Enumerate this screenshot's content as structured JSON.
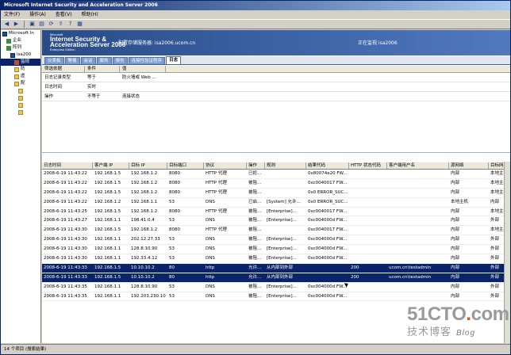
{
  "window": {
    "title": "Microsoft Internet Security and Acceleration Server 2006"
  },
  "menubar": [
    "文件(F)",
    "操作(A)",
    "查看(V)",
    "帮助(H)"
  ],
  "tree": [
    {
      "label": "Microsoft In",
      "icon": "server-icon",
      "indent": 0
    },
    {
      "label": "企业",
      "icon": "group-icon",
      "indent": 1
    },
    {
      "label": "阵列",
      "icon": "group-icon",
      "indent": 1
    },
    {
      "label": "isa200",
      "icon": "server-icon",
      "indent": 2
    },
    {
      "label": "监视",
      "icon": "monitor-icon",
      "indent": 3,
      "selected": true
    },
    {
      "label": "防",
      "icon": "folder-icon",
      "indent": 3
    },
    {
      "label": "虚",
      "icon": "folder-icon",
      "indent": 3
    },
    {
      "label": "配",
      "icon": "folder-icon",
      "indent": 3
    },
    {
      "label": "",
      "icon": "folder-icon",
      "indent": 4
    },
    {
      "label": "",
      "icon": "folder-icon",
      "indent": 4
    },
    {
      "label": "",
      "icon": "folder-icon",
      "indent": 4
    },
    {
      "label": "",
      "icon": "folder-icon",
      "indent": 4
    }
  ],
  "banner": {
    "logo_ms": "Microsoft",
    "logo_line1": "Internet Security &",
    "logo_line2": "Acceleration Server 2006",
    "logo_edition": "Enterprise Edition",
    "config_text": "配置存储服务器: isa2006.ucom.cn",
    "monitor_text": "正在监视 isa2006"
  },
  "tabs": [
    "仪表板",
    "警报",
    "会话",
    "服务",
    "报告",
    "连接性验证程序",
    "日志"
  ],
  "active_tab": 6,
  "filter": {
    "headers": [
      "筛选依据",
      "条件",
      "值"
    ],
    "rows": [
      [
        "日志记录类型",
        "等于",
        "防火墙或 Web ..."
      ],
      [
        "日志时间",
        "实时",
        ""
      ],
      [
        "操作",
        "不等于",
        "连接状态"
      ]
    ]
  },
  "log": {
    "headers": [
      "日志时间",
      "客户端 IP",
      "目标 IP",
      "目标端口",
      "协议",
      "操作",
      "规则",
      "结果代码",
      "HTTP 状态代码",
      "客户端用户名",
      "源网络",
      "目标网"
    ],
    "rows": [
      {
        "cells": [
          "2008-6-19 11:43:22",
          "192.168.1.5",
          "192.168.1.2",
          "8080",
          "HTTP 代理",
          "已拒...",
          "",
          "0x80074e20 FW...",
          "",
          "",
          "内部",
          "本地主"
        ],
        "selected": false
      },
      {
        "cells": [
          "2008-6-19 11:43:22",
          "192.168.1.5",
          "192.168.1.2",
          "8080",
          "HTTP 代理",
          "被阻...",
          "",
          "0xc0040017 FW...",
          "",
          "",
          "内部",
          "本地主"
        ],
        "selected": false
      },
      {
        "cells": [
          "2008-6-19 11:43:22",
          "192.168.1.5",
          "192.168.1.2",
          "8080",
          "HTTP 代理",
          "被阻...",
          "",
          "0x0 ERROR_SUC...",
          "",
          "",
          "内部",
          "本地主"
        ],
        "selected": false
      },
      {
        "cells": [
          "2008-6-19 11:43:22",
          "192.168.1.2",
          "192.168.1.1",
          "53",
          "DNS",
          "已启...",
          "[System] 允许...",
          "0x0 ERROR_SUC...",
          "",
          "",
          "本地主机",
          "内部"
        ],
        "selected": false
      },
      {
        "cells": [
          "2008-6-19 11:43:25",
          "192.168.1.5",
          "192.168.1.2",
          "8080",
          "HTTP 代理",
          "被阻...",
          "[Enterprise]...",
          "0xc0040017 FW...",
          "",
          "",
          "内部",
          "本地主"
        ],
        "selected": false
      },
      {
        "cells": [
          "2008-6-19 11:43:27",
          "192.168.1.1",
          "198.41.0.4",
          "53",
          "DNS",
          "被阻...",
          "[Enterprise]...",
          "0xc004000d FW...",
          "",
          "",
          "内部",
          "外部"
        ],
        "selected": false
      },
      {
        "cells": [
          "2008-6-19 11:43:30",
          "192.168.1.5",
          "192.168.1.2",
          "8080",
          "HTTP 代理",
          "被阻...",
          "",
          "0xc0040017 FW...",
          "",
          "",
          "内部",
          "本地主"
        ],
        "selected": false
      },
      {
        "cells": [
          "2008-6-19 11:43:30",
          "192.168.1.1",
          "202.12.27.33",
          "53",
          "DNS",
          "被阻...",
          "[Enterprise]...",
          "0xc004000d FW...",
          "",
          "",
          "内部",
          "外部"
        ],
        "selected": false
      },
      {
        "cells": [
          "2008-6-19 11:43:30",
          "192.168.1.1",
          "128.8.10.90",
          "53",
          "DNS",
          "被阻...",
          "[Enterprise]...",
          "0xc004000d FW...",
          "",
          "",
          "内部",
          "外部"
        ],
        "selected": false
      },
      {
        "cells": [
          "2008-6-19 11:43:30",
          "192.168.1.1",
          "192.33.4.12",
          "53",
          "DNS",
          "被阻...",
          "[Enterprise]...",
          "0xc004000d FW...",
          "",
          "",
          "内部",
          "外部"
        ],
        "selected": false
      },
      {
        "cells": [
          "2008-6-19 11:43:33",
          "192.168.1.5",
          "10.10.10.2",
          "80",
          "http",
          "允许...",
          "从内部到外部",
          "",
          "200",
          "ucom.cn\\testadmin",
          "内部",
          "外部"
        ],
        "selected": true
      },
      {
        "cells": [
          "2008-6-19 11:43:33",
          "192.168.1.5",
          "10.10.10.2",
          "80",
          "http",
          "允许...",
          "从内部到外部",
          "",
          "200",
          "ucom.cn\\testadmin",
          "内部",
          "外部"
        ],
        "selected": true
      },
      {
        "cells": [
          "2008-6-19 11:43:35",
          "192.168.1.1",
          "128.8.10.90",
          "53",
          "DNS",
          "被阻...",
          "[Enterprise]...",
          "0xc004000d FW...",
          "",
          "",
          "内部",
          "外部"
        ],
        "selected": false
      },
      {
        "cells": [
          "2008-6-19 11:43:35",
          "192.168.1.1",
          "192.203.230.10",
          "53",
          "DNS",
          "被阻...",
          "[Enterprise]...",
          "0xc004000d FW...",
          "",
          "",
          "内部",
          "外部"
        ],
        "selected": false
      }
    ]
  },
  "statusbar": "14 个项目  (搜索结果)",
  "watermark": {
    "site_main": "51CTO",
    "site_dot": ".",
    "site_tld": "com",
    "sub": "技术博客",
    "blog": "Blog"
  },
  "colors": {
    "selection": "#0a246a",
    "banner": "#3d64a7",
    "titlebar": "#0a246a"
  }
}
